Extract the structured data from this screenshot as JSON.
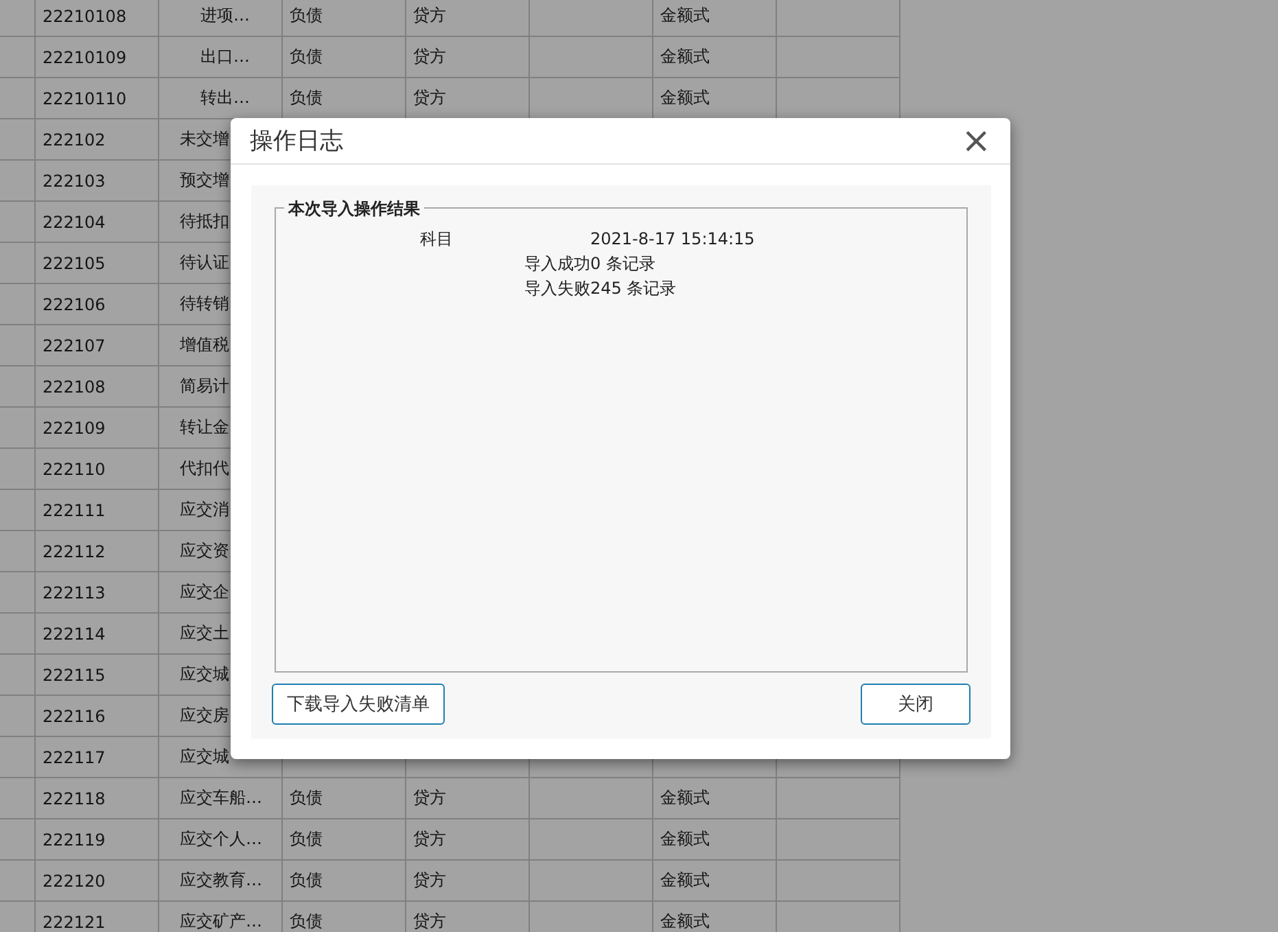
{
  "table": {
    "rows": [
      {
        "kind": "sub",
        "code": "22210108",
        "name": "进项…",
        "category": "负债",
        "direction": "贷方",
        "format": "金额式"
      },
      {
        "kind": "sub",
        "code": "22210109",
        "name": "出口…",
        "category": "负债",
        "direction": "贷方",
        "format": "金额式"
      },
      {
        "kind": "sub",
        "code": "22210110",
        "name": "转出…",
        "category": "负债",
        "direction": "贷方",
        "format": "金额式"
      },
      {
        "kind": "top",
        "code": "222102",
        "name": "未交增"
      },
      {
        "kind": "top",
        "code": "222103",
        "name": "预交增"
      },
      {
        "kind": "top",
        "code": "222104",
        "name": "待抵扣"
      },
      {
        "kind": "top",
        "code": "222105",
        "name": "待认证"
      },
      {
        "kind": "top",
        "code": "222106",
        "name": "待转销"
      },
      {
        "kind": "top",
        "code": "222107",
        "name": "增值税"
      },
      {
        "kind": "top",
        "code": "222108",
        "name": "简易计"
      },
      {
        "kind": "top",
        "code": "222109",
        "name": "转让金"
      },
      {
        "kind": "top",
        "code": "222110",
        "name": "代扣代"
      },
      {
        "kind": "top",
        "code": "222111",
        "name": "应交消"
      },
      {
        "kind": "top",
        "code": "222112",
        "name": "应交资"
      },
      {
        "kind": "top",
        "code": "222113",
        "name": "应交企"
      },
      {
        "kind": "top",
        "code": "222114",
        "name": "应交土"
      },
      {
        "kind": "top",
        "code": "222115",
        "name": "应交城"
      },
      {
        "kind": "top",
        "code": "222116",
        "name": "应交房"
      },
      {
        "kind": "top",
        "code": "222117",
        "name": "应交城"
      },
      {
        "kind": "top",
        "code": "222118",
        "name": "应交车船…",
        "category": "负债",
        "direction": "贷方",
        "format": "金额式"
      },
      {
        "kind": "top",
        "code": "222119",
        "name": "应交个人…",
        "category": "负债",
        "direction": "贷方",
        "format": "金额式"
      },
      {
        "kind": "top",
        "code": "222120",
        "name": "应交教育…",
        "category": "负债",
        "direction": "贷方",
        "format": "金额式"
      },
      {
        "kind": "top",
        "code": "222121",
        "name": "应交矿产…",
        "category": "负债",
        "direction": "贷方",
        "format": "金额式"
      }
    ]
  },
  "dialog": {
    "title": "操作日志",
    "close_icon": "×",
    "group_title": "本次导入操作结果",
    "subject": "科目",
    "time": "2021-8-17 15:14:15",
    "lines": [
      "导入成功0 条记录",
      "导入失败245 条记录"
    ],
    "download_button": "下载导入失败清单",
    "close_button": "关闭"
  }
}
